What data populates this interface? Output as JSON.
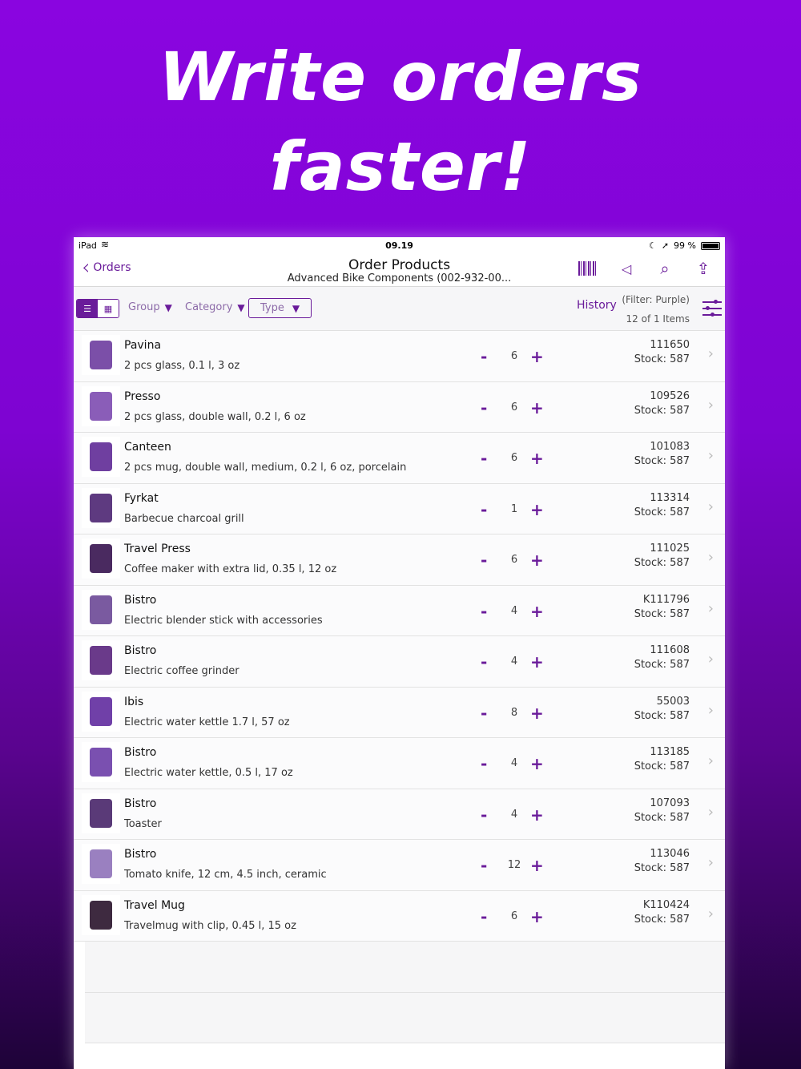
{
  "headline": {
    "line1": "Write orders",
    "line2": "faster!"
  },
  "status": {
    "carrier": "iPad",
    "time": "09.19",
    "battery": "99 %"
  },
  "nav": {
    "back_label": "Orders",
    "title": "Order Products",
    "subtitle": "Advanced Bike Components (002-932-00..."
  },
  "toolbar": {
    "group": "Group",
    "category": "Category",
    "type": "Type",
    "history": "History",
    "filter": "(Filter: Purple)",
    "count": "12 of 1 Items"
  },
  "accent": "#6a1b9a",
  "products": [
    {
      "name": "Pavina",
      "desc": "2 pcs glass, 0.1 l, 3 oz",
      "qty": "6",
      "sku": "111650",
      "stock": "Stock: 587"
    },
    {
      "name": "Presso",
      "desc": "2 pcs glass, double wall, 0.2 l, 6 oz",
      "qty": "6",
      "sku": "109526",
      "stock": "Stock: 587"
    },
    {
      "name": "Canteen",
      "desc": "2 pcs mug, double wall, medium, 0.2 l, 6 oz, porcelain",
      "qty": "6",
      "sku": "101083",
      "stock": "Stock: 587"
    },
    {
      "name": "Fyrkat",
      "desc": "Barbecue charcoal grill",
      "qty": "1",
      "sku": "113314",
      "stock": "Stock: 587"
    },
    {
      "name": "Travel Press",
      "desc": "Coffee maker with extra lid, 0.35 l, 12 oz",
      "qty": "6",
      "sku": "111025",
      "stock": "Stock: 587"
    },
    {
      "name": "Bistro",
      "desc": "Electric blender stick with accessories",
      "qty": "4",
      "sku": "K111796",
      "stock": "Stock: 587"
    },
    {
      "name": "Bistro",
      "desc": "Electric coffee grinder",
      "qty": "4",
      "sku": "111608",
      "stock": "Stock: 587"
    },
    {
      "name": "Ibis",
      "desc": "Electric water kettle 1.7 l, 57 oz",
      "qty": "8",
      "sku": "55003",
      "stock": "Stock: 587"
    },
    {
      "name": "Bistro",
      "desc": "Electric water kettle, 0.5 l, 17 oz",
      "qty": "4",
      "sku": "113185",
      "stock": "Stock: 587"
    },
    {
      "name": "Bistro",
      "desc": "Toaster",
      "qty": "4",
      "sku": "107093",
      "stock": "Stock: 587"
    },
    {
      "name": "Bistro",
      "desc": "Tomato knife, 12 cm, 4.5 inch, ceramic",
      "qty": "12",
      "sku": "113046",
      "stock": "Stock: 587"
    },
    {
      "name": "Travel Mug",
      "desc": "Travelmug with clip, 0.45 l, 15 oz",
      "qty": "6",
      "sku": "K110424",
      "stock": "Stock: 587"
    }
  ]
}
